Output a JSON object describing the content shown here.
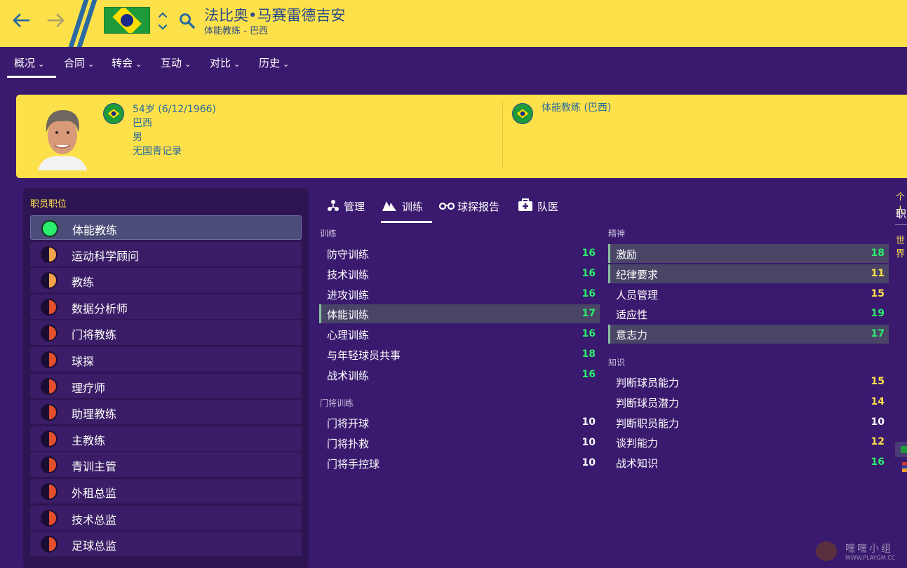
{
  "header": {
    "title": "法比奥•马赛雷德吉安",
    "subtitle": "体能教练 - 巴西",
    "back_icon": "back-arrow-icon",
    "forward_icon": "forward-arrow-icon",
    "search_icon": "search-icon"
  },
  "nav_tabs": [
    {
      "label": "概况",
      "active": true
    },
    {
      "label": "合同"
    },
    {
      "label": "转会"
    },
    {
      "label": "互动"
    },
    {
      "label": "对比"
    },
    {
      "label": "历史"
    }
  ],
  "profile": {
    "age_dob": "54岁 (6/12/1966)",
    "nationality": "巴西",
    "gender": "男",
    "youth_record": "无国青记录",
    "job": "体能教练 (巴西)"
  },
  "roles_panel": {
    "heading": "职员职位",
    "roles": [
      {
        "label": "体能教练",
        "color": "#2bef6c",
        "selected": true
      },
      {
        "label": "运动科学顾问",
        "color": "#f2a24a"
      },
      {
        "label": "教练",
        "color": "#f2a24a"
      },
      {
        "label": "数据分析师",
        "color": "#e4502e"
      },
      {
        "label": "门将教练",
        "color": "#e4502e"
      },
      {
        "label": "球探",
        "color": "#e4502e"
      },
      {
        "label": "理疗师",
        "color": "#e4502e"
      },
      {
        "label": "助理教练",
        "color": "#e4502e"
      },
      {
        "label": "主教练",
        "color": "#e4502e"
      },
      {
        "label": "青训主管",
        "color": "#e4502e"
      },
      {
        "label": "外租总监",
        "color": "#e4502e"
      },
      {
        "label": "技术总监",
        "color": "#e4502e"
      },
      {
        "label": "足球总监",
        "color": "#e4502e"
      }
    ]
  },
  "attr_tabs": [
    {
      "label": "管理",
      "icon": "management-icon"
    },
    {
      "label": "训练",
      "icon": "training-icon",
      "active": true
    },
    {
      "label": "球探报告",
      "icon": "binoculars-icon"
    },
    {
      "label": "队医",
      "icon": "medical-kit-icon"
    }
  ],
  "sections": {
    "training": {
      "heading": "训练",
      "items": [
        {
          "name": "防守训练",
          "value": "16"
        },
        {
          "name": "技术训练",
          "value": "16"
        },
        {
          "name": "进攻训练",
          "value": "16"
        },
        {
          "name": "体能训练",
          "value": "17"
        },
        {
          "name": "心理训练",
          "value": "16"
        },
        {
          "name": "与年轻球员共事",
          "value": "18"
        },
        {
          "name": "战术训练",
          "value": "16"
        }
      ]
    },
    "goalkeeping": {
      "heading": "门将训练",
      "items": [
        {
          "name": "门将开球",
          "value": "10"
        },
        {
          "name": "门将扑救",
          "value": "10"
        },
        {
          "name": "门将手控球",
          "value": "10"
        }
      ]
    },
    "mental": {
      "heading": "精神",
      "items": [
        {
          "name": "激励",
          "value": "18"
        },
        {
          "name": "纪律要求",
          "value": "11"
        },
        {
          "name": "人员管理",
          "value": "15"
        },
        {
          "name": "适应性",
          "value": "19"
        },
        {
          "name": "意志力",
          "value": "17"
        }
      ]
    },
    "knowledge": {
      "heading": "知识",
      "items": [
        {
          "name": "判断球员能力",
          "value": "15"
        },
        {
          "name": "判断球员潜力",
          "value": "14"
        },
        {
          "name": "判断职员能力",
          "value": "10"
        },
        {
          "name": "谈判能力",
          "value": "12"
        },
        {
          "name": "战术知识",
          "value": "16"
        }
      ]
    }
  },
  "edge": {
    "line1": "个人",
    "line2": "职",
    "line3": "世界"
  },
  "colors": {
    "yellow": "#fde14a",
    "purple": "#3a1a6e",
    "value_green": "#2bef6c",
    "value_yellow": "#fde14a",
    "value_white": "#ffffff"
  },
  "watermark": {
    "line1": "嘿嘿小组",
    "line2": "WWW.PLAYGM.CC"
  }
}
